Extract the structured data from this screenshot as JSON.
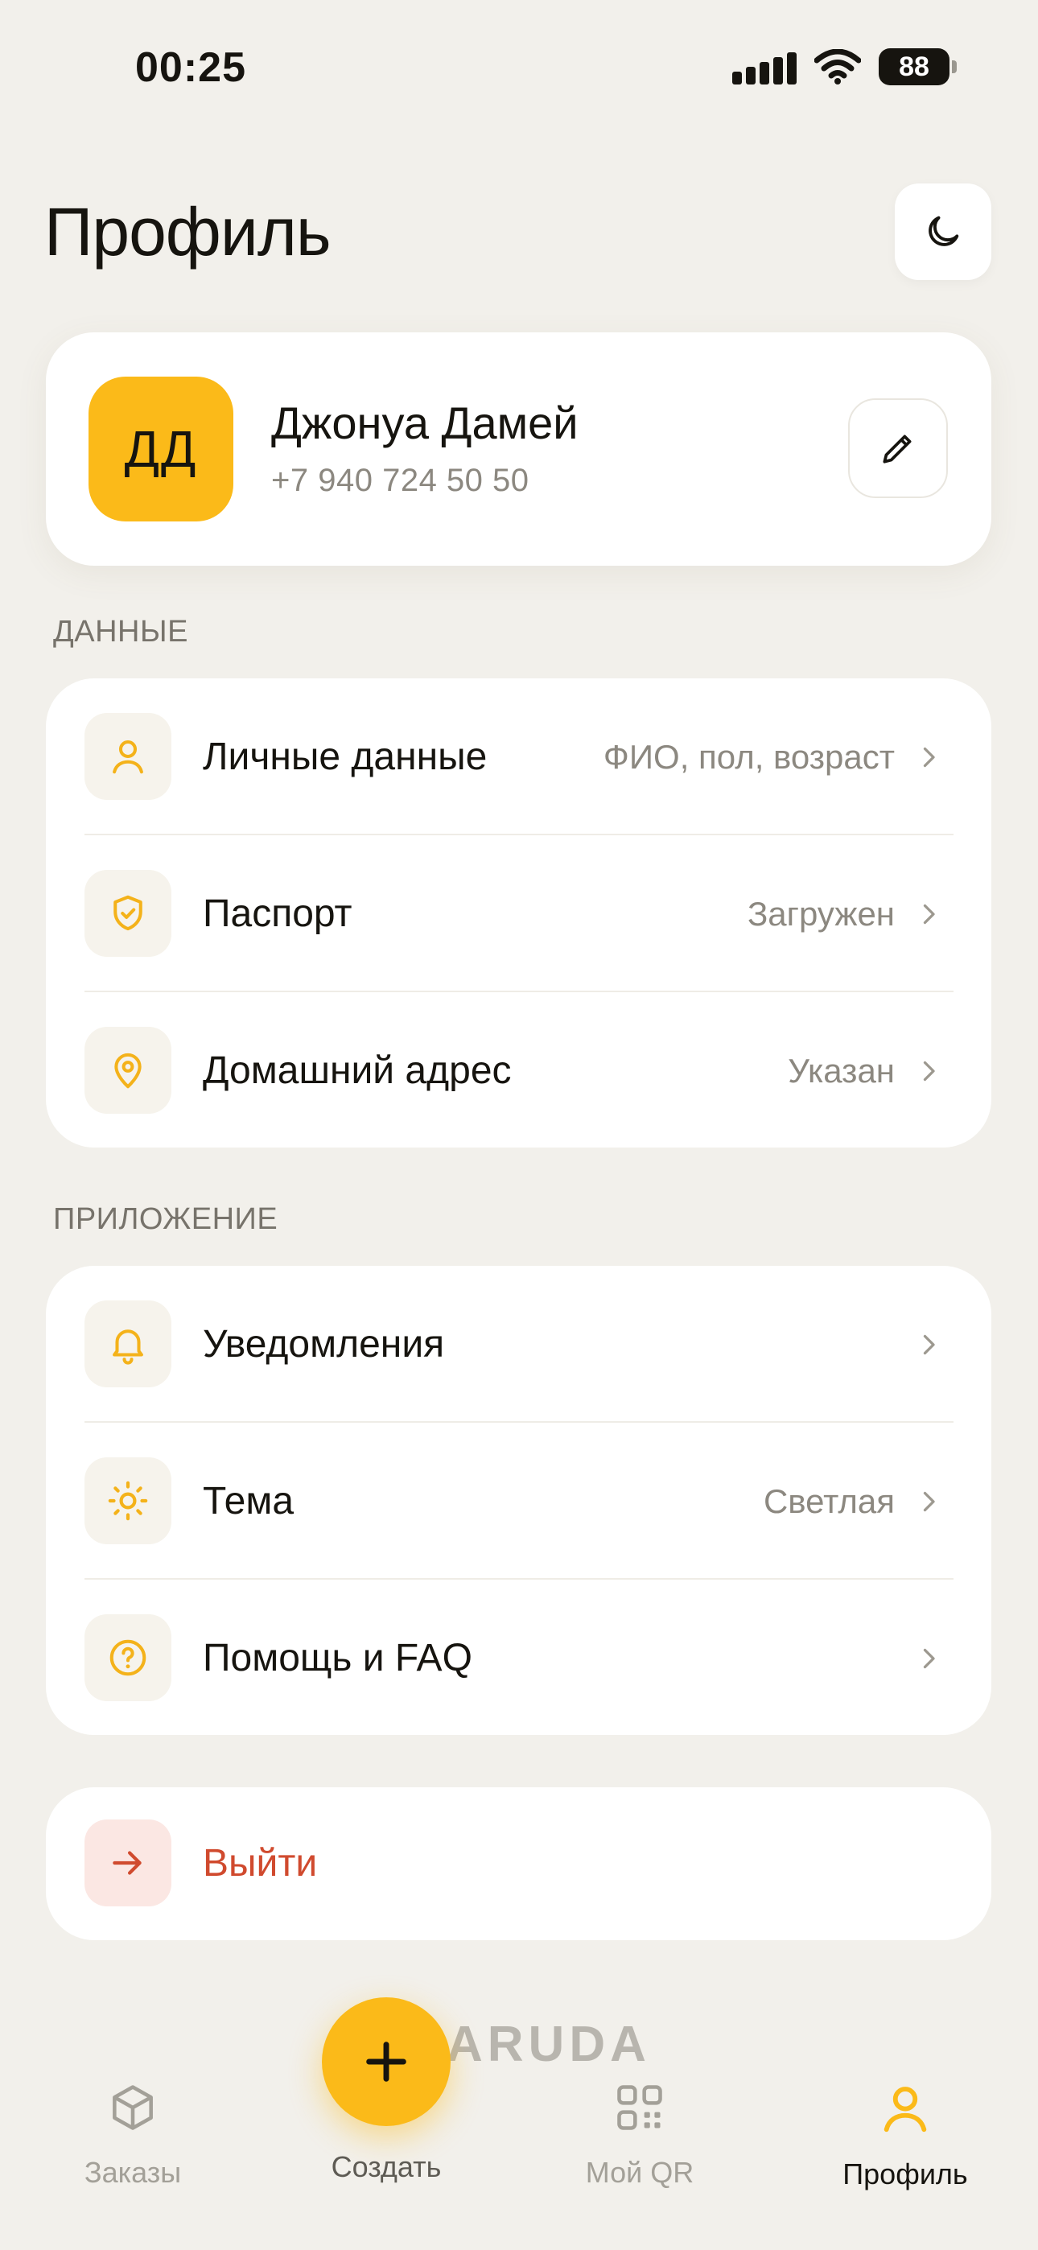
{
  "status_bar": {
    "time": "00:25",
    "battery": "88"
  },
  "header": {
    "title": "Профиль"
  },
  "profile": {
    "initials": "ДД",
    "name": "Джонуа Дамей",
    "phone": "+7 940 724 50 50"
  },
  "sections": {
    "data": {
      "label": "ДАННЫЕ",
      "items": [
        {
          "title": "Личные данные",
          "value": "ФИО, пол, возраст"
        },
        {
          "title": "Паспорт",
          "value": "Загружен"
        },
        {
          "title": "Домашний адрес",
          "value": "Указан"
        }
      ]
    },
    "app": {
      "label": "ПРИЛОЖЕНИЕ",
      "items": [
        {
          "title": "Уведомления",
          "value": ""
        },
        {
          "title": "Тема",
          "value": "Светлая"
        },
        {
          "title": "Помощь и FAQ",
          "value": ""
        }
      ]
    }
  },
  "logout": {
    "label": "Выйти"
  },
  "brand": {
    "watermark": "ARUDA"
  },
  "nav": {
    "orders": "Заказы",
    "create": "Создать",
    "qr": "Мой QR",
    "profile": "Профиль"
  },
  "colors": {
    "accent": "#FBBA19",
    "danger": "#D04A2E",
    "background": "#F2F0EB"
  },
  "icons": {
    "theme": "moon-icon",
    "edit": "pencil-icon",
    "personal": "user-icon",
    "passport": "shield-check-icon",
    "address": "map-pin-icon",
    "notifications": "bell-icon",
    "theme_row": "sun-icon",
    "help": "help-circle-icon",
    "logout": "arrow-right-icon",
    "orders": "box-icon",
    "create": "plus-icon",
    "qr": "qr-code-icon",
    "profile_nav": "user-icon"
  }
}
